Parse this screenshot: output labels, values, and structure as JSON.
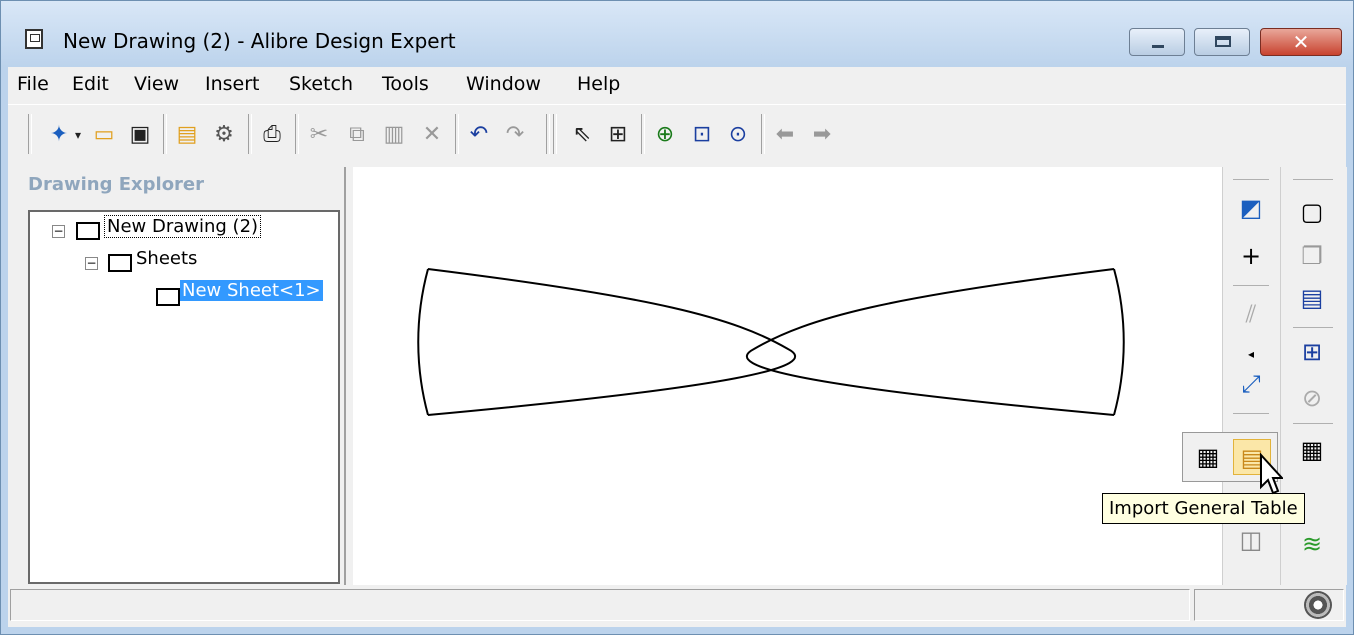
{
  "window": {
    "title": "New Drawing (2) - Alibre Design Expert",
    "close_glyph": "✕"
  },
  "menu": [
    "File",
    "Edit",
    "View",
    "Insert",
    "Sketch",
    "Tools",
    "Window",
    "Help"
  ],
  "toolbar_icons": [
    "new-icon",
    "dropdown-arrow-icon",
    "open-folder-icon",
    "save-icon",
    "open-workspace-icon",
    "settings-gear-icon",
    "print-icon",
    "cut-icon",
    "copy-icon",
    "paste-icon",
    "delete-icon",
    "undo-icon",
    "redo-icon",
    "select-arrow-icon",
    "zoom-fit-icon",
    "zoom-in-icon",
    "zoom-window-icon",
    "zoom-icon",
    "back-arrow-icon",
    "forward-arrow-icon"
  ],
  "explorer": {
    "title": "Drawing Explorer",
    "tree": {
      "root": "New Drawing (2)",
      "sheets": "Sheets",
      "sheet": "New Sheet<1>"
    }
  },
  "tooltip": "Import General Table",
  "colors": {
    "window_frame": "#bcd3ec",
    "selection": "#3399ff",
    "tooltip_bg": "#ffffe1",
    "close_button": "#c8432f"
  }
}
